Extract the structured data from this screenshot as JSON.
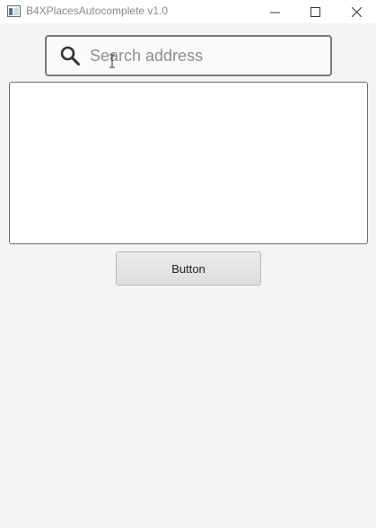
{
  "window": {
    "title": "B4XPlacesAutocomplete v1.0",
    "app_icon": "app-window-icon",
    "controls": {
      "minimize_icon": "minimize-icon",
      "maximize_icon": "maximize-icon",
      "close_icon": "close-icon"
    }
  },
  "search": {
    "placeholder": "Search address",
    "value": "",
    "icon": "search-icon"
  },
  "results": {
    "items": []
  },
  "action": {
    "label": "Button"
  },
  "colors": {
    "background": "#f4f4f4",
    "search_border": "#7a7a7a",
    "list_border": "#6e6e6e",
    "title_text": "#8a8a8a"
  }
}
